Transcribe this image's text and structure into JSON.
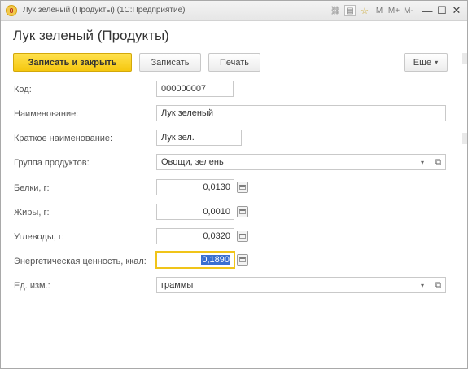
{
  "window": {
    "title": "Лук зеленый (Продукты)  (1С:Предприятие)",
    "icons": [
      "app-1c-icon",
      "link-icon",
      "bookmark-icon",
      "star-icon",
      "memory-icons",
      "minimize-icon",
      "maximize-icon",
      "close-icon"
    ]
  },
  "titlebar_glyphs": {
    "link": "⛓",
    "doc": "▤",
    "star": "☆",
    "m": "M",
    "mplus": "M+",
    "mminus": "M-",
    "minimize": "—",
    "maximize": "☐",
    "close": "✕"
  },
  "form": {
    "title": "Лук зеленый (Продукты)"
  },
  "toolbar": {
    "save_close_label": "Записать и закрыть",
    "save_label": "Записать",
    "print_label": "Печать",
    "more_label": "Еще",
    "more_arrow": "▾"
  },
  "fields": {
    "code": {
      "label": "Код:",
      "value": "000000007"
    },
    "name": {
      "label": "Наименование:",
      "value": "Лук зеленый"
    },
    "short_name": {
      "label": "Краткое наименование:",
      "value": "Лук зел."
    },
    "group": {
      "label": "Группа продуктов:",
      "value": "Овощи, зелень"
    },
    "protein": {
      "label": "Белки, г:",
      "value": "0,0130"
    },
    "fat": {
      "label": "Жиры, г:",
      "value": "0,0010"
    },
    "carbs": {
      "label": "Углеводы, г:",
      "value": "0,0320"
    },
    "energy": {
      "label": "Энергетическая ценность, ккал:",
      "value": "0,1890"
    },
    "unit": {
      "label": "Ед. изм.:",
      "value": "граммы"
    }
  },
  "controls": {
    "dropdown_arrow": "▾",
    "open_glyph": "⧉"
  },
  "colors": {
    "primary_button": "#f5c70f",
    "active_field_border": "#f0c419",
    "selection": "#3a6fd0"
  }
}
